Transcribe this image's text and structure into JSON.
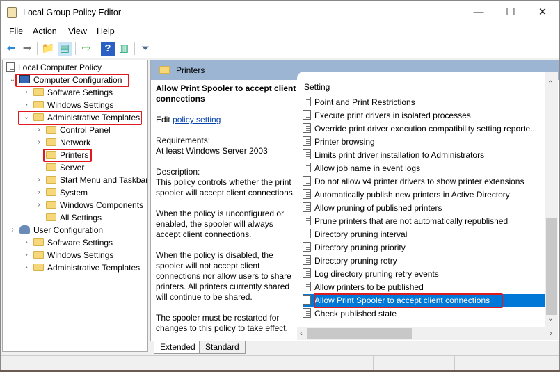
{
  "window": {
    "title": "Local Group Policy Editor",
    "minimize": "—",
    "maximize": "☐",
    "close": "✕"
  },
  "menu": [
    "File",
    "Action",
    "View",
    "Help"
  ],
  "tree": {
    "root": "Local Computer Policy",
    "computer_config": "Computer Configuration",
    "cc_items": [
      "Software Settings",
      "Windows Settings",
      "Administrative Templates"
    ],
    "admin_items": [
      "Control Panel",
      "Network",
      "Printers",
      "Server",
      "Start Menu and Taskbar",
      "System",
      "Windows Components",
      "All Settings"
    ],
    "user_config": "User Configuration",
    "uc_items": [
      "Software Settings",
      "Windows Settings",
      "Administrative Templates"
    ]
  },
  "right": {
    "header": "Printers",
    "description": {
      "title": "Allow Print Spooler to accept client connections",
      "edit_prefix": "Edit ",
      "edit_link": "policy setting",
      "requirements": "Requirements:\nAt least Windows Server 2003",
      "description": "Description:\nThis policy controls whether the print spooler will accept client connections.",
      "p1": "When the policy is unconfigured or enabled, the spooler will always accept client connections.",
      "p2": "When the policy is disabled, the spooler will not accept client connections nor allow users to share printers.  All printers currently shared will continue to be shared.",
      "p3": "The spooler must be restarted for changes to this policy to take effect."
    },
    "column_header": "Setting",
    "settings": [
      "Point and Print Restrictions",
      "Execute print drivers in isolated processes",
      "Override print driver execution compatibility setting reporte...",
      "Printer browsing",
      "Limits print driver installation to Administrators",
      "Allow job name in event logs",
      "Do not allow v4 printer drivers to show printer extensions",
      "Automatically publish new printers in Active Directory",
      "Allow pruning of published printers",
      "Prune printers that are not automatically republished",
      "Directory pruning interval",
      "Directory pruning priority",
      "Directory pruning retry",
      "Log directory pruning retry events",
      "Allow printers to be published",
      "Allow Print Spooler to accept client connections",
      "Check published state"
    ],
    "selected_index": 15
  },
  "tabs": [
    "Extended",
    "Standard"
  ],
  "colors": {
    "highlight": "#e0191e",
    "selection": "#0078d7",
    "header": "#9bb5d3"
  }
}
